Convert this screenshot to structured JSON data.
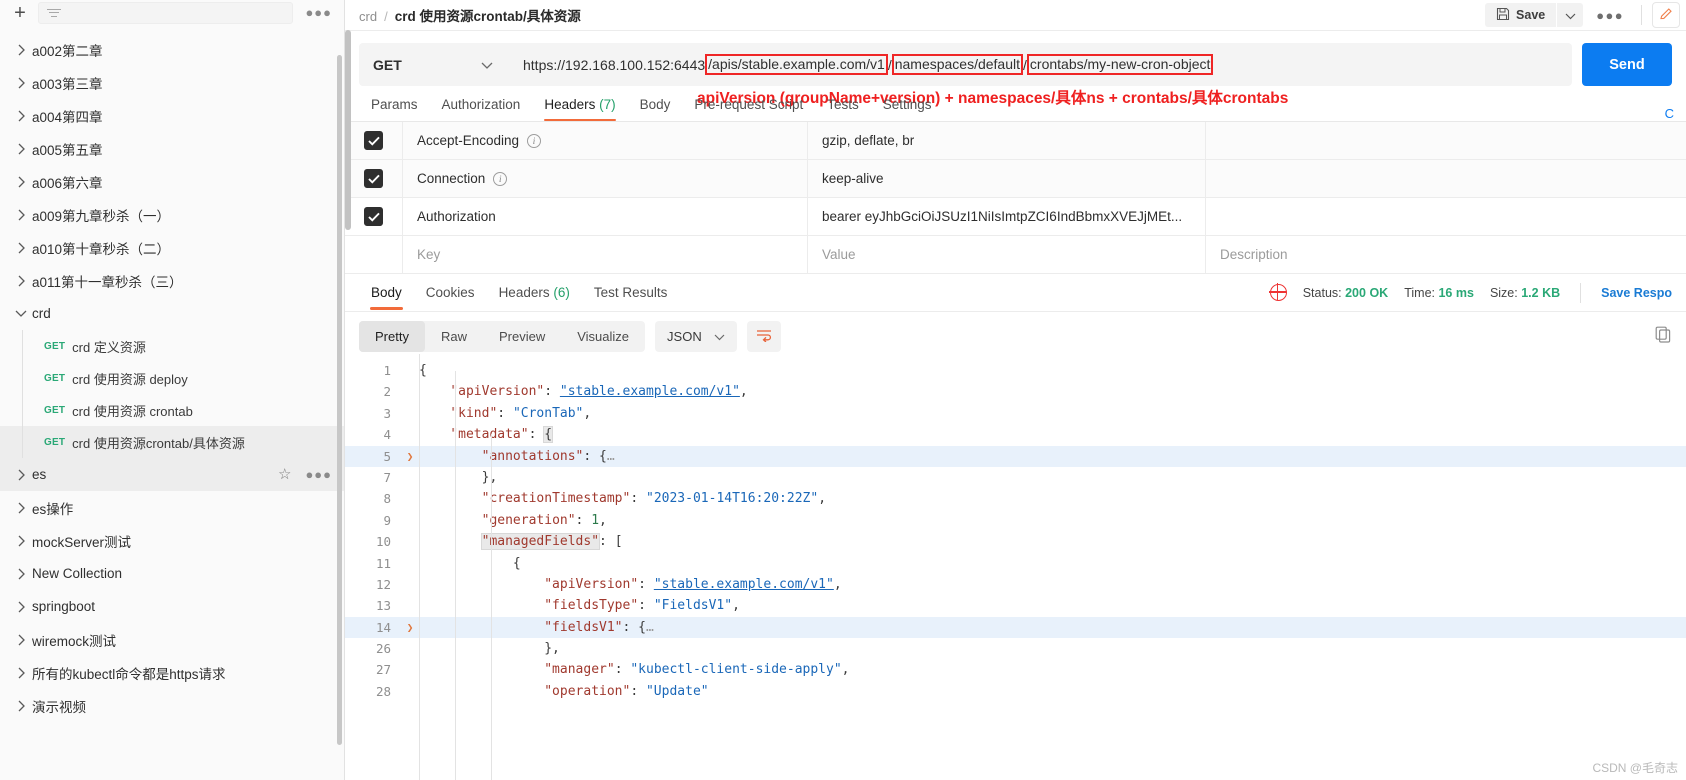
{
  "sidebar": {
    "add_label": "+",
    "filter_icon": "filter-icon",
    "more_label": "000",
    "collections": [
      {
        "label": "a002第二章",
        "expanded": false
      },
      {
        "label": "a003第三章",
        "expanded": false
      },
      {
        "label": "a004第四章",
        "expanded": false
      },
      {
        "label": "a005第五章",
        "expanded": false
      },
      {
        "label": "a006第六章",
        "expanded": false
      },
      {
        "label": "a009第九章秒杀（一）",
        "expanded": false
      },
      {
        "label": "a010第十章秒杀（二）",
        "expanded": false
      },
      {
        "label": "a011第十一章秒杀（三）",
        "expanded": false
      },
      {
        "label": "crd",
        "expanded": true
      },
      {
        "label": "es",
        "expanded": false,
        "selected": true,
        "has_actions": true
      },
      {
        "label": "es操作",
        "expanded": false
      },
      {
        "label": "mockServer测试",
        "expanded": false
      },
      {
        "label": "New Collection",
        "expanded": false
      },
      {
        "label": "springboot",
        "expanded": false
      },
      {
        "label": "wiremock测试",
        "expanded": false
      },
      {
        "label": "所有的kubectl命令都是https请求",
        "expanded": false
      },
      {
        "label": "演示视频",
        "expanded": false
      }
    ],
    "crd_requests": [
      {
        "method": "GET",
        "label": "crd 定义资源",
        "selected": false
      },
      {
        "method": "GET",
        "label": "crd 使用资源 deploy",
        "selected": false
      },
      {
        "method": "GET",
        "label": "crd 使用资源 crontab",
        "selected": false
      },
      {
        "method": "GET",
        "label": "crd 使用资源crontab/具体资源",
        "selected": true
      }
    ]
  },
  "header": {
    "breadcrumb_parent": "crd",
    "breadcrumb_sep": "/",
    "breadcrumb_current": "crd 使用资源crontab/具体资源",
    "save_label": "Save",
    "save_icon": "floppy-disk-icon",
    "caret_icon": "chevron-down-icon",
    "more_icon": "ellipsis-icon",
    "edit_icon": "pencil-icon"
  },
  "request": {
    "method": "GET",
    "url_plain": "https://192.168.100.152:6443",
    "url_part_1": "/apis/stable.example.com/v1",
    "url_sep_1": "/",
    "url_part_2": "namespaces/default",
    "url_sep_2": "/",
    "url_part_3": "crontabs/my-new-cron-object",
    "annotation": "apiVersion (groupName+version) + namespaces/具体ns + crontabs/具体crontabs",
    "send_label": "Send",
    "tabs": [
      {
        "label": "Params",
        "active": false
      },
      {
        "label": "Authorization",
        "active": false
      },
      {
        "label": "Headers",
        "count": "(7)",
        "active": true
      },
      {
        "label": "Body",
        "active": false
      },
      {
        "label": "Pre-request Script",
        "active": false
      },
      {
        "label": "Tests",
        "active": false
      },
      {
        "label": "Settings",
        "active": false
      }
    ],
    "cookies_link": "C"
  },
  "headers_table": {
    "columns": {
      "key": "Key",
      "value": "Value",
      "description": "Description"
    },
    "rows": [
      {
        "checked": true,
        "key": "Accept-Encoding",
        "info": true,
        "value": "gzip, deflate, br",
        "description": ""
      },
      {
        "checked": true,
        "key": "Connection",
        "info": true,
        "value": "keep-alive",
        "description": ""
      },
      {
        "checked": true,
        "key": "Authorization",
        "info": false,
        "value": "bearer eyJhbGciOiJSUzI1NiIsImtpZCI6IndBbmxXVEJjMEt...",
        "description": ""
      }
    ]
  },
  "response": {
    "tabs": [
      {
        "label": "Body",
        "active": true
      },
      {
        "label": "Cookies",
        "active": false
      },
      {
        "label": "Headers",
        "count": "(6)",
        "active": false
      },
      {
        "label": "Test Results",
        "active": false
      }
    ],
    "status_label": "Status:",
    "status_value": "200 OK",
    "time_label": "Time:",
    "time_value": "16 ms",
    "size_label": "Size:",
    "size_value": "1.2 KB",
    "save_response": "Save Respo",
    "globe_icon": "globe-icon",
    "view_modes": [
      {
        "label": "Pretty",
        "active": true
      },
      {
        "label": "Raw",
        "active": false
      },
      {
        "label": "Preview",
        "active": false
      },
      {
        "label": "Visualize",
        "active": false
      }
    ],
    "format": "JSON",
    "format_caret": "chevron-down-icon",
    "wrap_icon": "wrap-lines-icon",
    "copy_icon": "copy-icon"
  },
  "body_code": {
    "lines": [
      {
        "num": "1",
        "indent": 0,
        "fold": false,
        "hl": false,
        "tokens": [
          {
            "t": "{",
            "c": "p"
          }
        ]
      },
      {
        "num": "2",
        "indent": 1,
        "fold": false,
        "hl": false,
        "tokens": [
          {
            "t": "\"apiVersion\"",
            "c": "k"
          },
          {
            "t": ": ",
            "c": "p"
          },
          {
            "t": "\"stable.example.com/v1\"",
            "c": "s",
            "u": true
          },
          {
            "t": ",",
            "c": "p"
          }
        ]
      },
      {
        "num": "3",
        "indent": 1,
        "fold": false,
        "hl": false,
        "tokens": [
          {
            "t": "\"kind\"",
            "c": "k"
          },
          {
            "t": ": ",
            "c": "p"
          },
          {
            "t": "\"CronTab\"",
            "c": "s"
          },
          {
            "t": ",",
            "c": "p"
          }
        ]
      },
      {
        "num": "4",
        "indent": 1,
        "fold": false,
        "hl": false,
        "tokens": [
          {
            "t": "\"metadata\"",
            "c": "k"
          },
          {
            "t": ": ",
            "c": "p"
          },
          {
            "t": "{",
            "c": "p",
            "box": true
          }
        ]
      },
      {
        "num": "5",
        "indent": 2,
        "fold": true,
        "hl": true,
        "tokens": [
          {
            "t": "\"annotations\"",
            "c": "k"
          },
          {
            "t": ": ",
            "c": "p"
          },
          {
            "t": "{",
            "c": "p"
          },
          {
            "t": "…",
            "c": "dim"
          }
        ]
      },
      {
        "num": "7",
        "indent": 2,
        "fold": false,
        "hl": false,
        "tokens": [
          {
            "t": "},",
            "c": "p"
          }
        ]
      },
      {
        "num": "8",
        "indent": 2,
        "fold": false,
        "hl": false,
        "tokens": [
          {
            "t": "\"creationTimestamp\"",
            "c": "k"
          },
          {
            "t": ": ",
            "c": "p"
          },
          {
            "t": "\"2023-01-14T16:20:22Z\"",
            "c": "s"
          },
          {
            "t": ",",
            "c": "p"
          }
        ]
      },
      {
        "num": "9",
        "indent": 2,
        "fold": false,
        "hl": false,
        "tokens": [
          {
            "t": "\"generation\"",
            "c": "k"
          },
          {
            "t": ": ",
            "c": "p"
          },
          {
            "t": "1",
            "c": "n"
          },
          {
            "t": ",",
            "c": "p"
          }
        ]
      },
      {
        "num": "10",
        "indent": 2,
        "fold": false,
        "hl": false,
        "tokens": [
          {
            "t": "\"managedFields\"",
            "c": "k",
            "box": true
          },
          {
            "t": ": ",
            "c": "p"
          },
          {
            "t": "[",
            "c": "p"
          }
        ]
      },
      {
        "num": "11",
        "indent": 3,
        "fold": false,
        "hl": false,
        "tokens": [
          {
            "t": "{",
            "c": "p"
          }
        ]
      },
      {
        "num": "12",
        "indent": 4,
        "fold": false,
        "hl": false,
        "tokens": [
          {
            "t": "\"apiVersion\"",
            "c": "k"
          },
          {
            "t": ": ",
            "c": "p"
          },
          {
            "t": "\"stable.example.com/v1\"",
            "c": "s",
            "u": true
          },
          {
            "t": ",",
            "c": "p"
          }
        ]
      },
      {
        "num": "13",
        "indent": 4,
        "fold": false,
        "hl": false,
        "tokens": [
          {
            "t": "\"fieldsType\"",
            "c": "k"
          },
          {
            "t": ": ",
            "c": "p"
          },
          {
            "t": "\"FieldsV1\"",
            "c": "s"
          },
          {
            "t": ",",
            "c": "p"
          }
        ]
      },
      {
        "num": "14",
        "indent": 4,
        "fold": true,
        "hl": true,
        "tokens": [
          {
            "t": "\"fieldsV1\"",
            "c": "k"
          },
          {
            "t": ": ",
            "c": "p"
          },
          {
            "t": "{",
            "c": "p"
          },
          {
            "t": "…",
            "c": "dim"
          }
        ]
      },
      {
        "num": "26",
        "indent": 4,
        "fold": false,
        "hl": false,
        "tokens": [
          {
            "t": "},",
            "c": "p"
          }
        ]
      },
      {
        "num": "27",
        "indent": 4,
        "fold": false,
        "hl": false,
        "tokens": [
          {
            "t": "\"manager\"",
            "c": "k"
          },
          {
            "t": ": ",
            "c": "p"
          },
          {
            "t": "\"kubectl-client-side-apply\"",
            "c": "s"
          },
          {
            "t": ",",
            "c": "p"
          }
        ]
      },
      {
        "num": "28",
        "indent": 4,
        "fold": false,
        "hl": false,
        "tokens": [
          {
            "t": "\"operation\"",
            "c": "k"
          },
          {
            "t": ": ",
            "c": "p"
          },
          {
            "t": "\"Update\"",
            "c": "s"
          }
        ]
      }
    ]
  },
  "watermark": "CSDN @毛奇志"
}
